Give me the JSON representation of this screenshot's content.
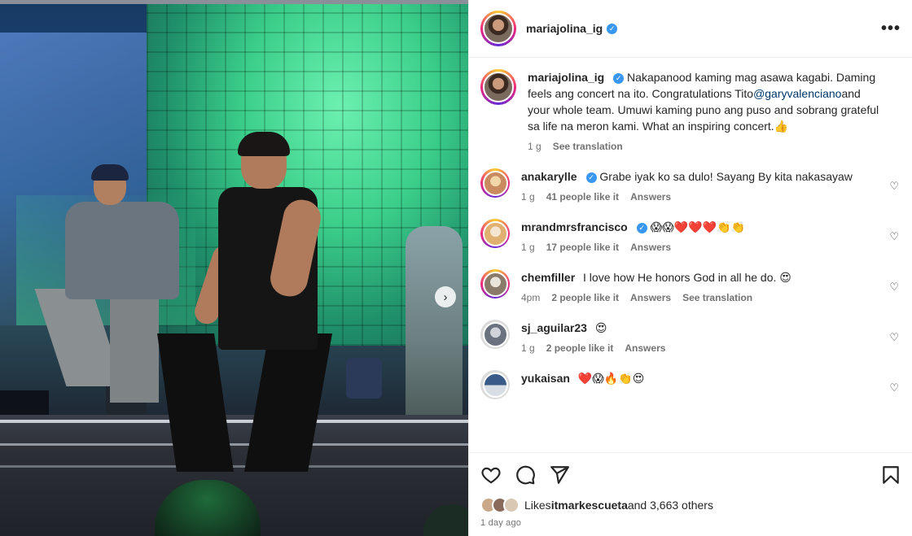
{
  "post": {
    "username": "mariajolina_ig",
    "verified_label": "✓",
    "more_label": "•••",
    "next_label": "›"
  },
  "caption": {
    "username": "mariajolina_ig",
    "text_part1": "Nakapanood kaming mag asawa kagabi. Daming feels ang concert na ito. Congratulations Tito",
    "mention": "@garyvalenciano",
    "text_part2": "and your whole team. Umuwi kaming puno ang puso and sobrang grateful sa life na meron kami. What an inspiring concert.👍",
    "time": "1 g",
    "translate": "See translation"
  },
  "comments": [
    {
      "username": "anakarylle",
      "verified": true,
      "text": "Grabe iyak ko sa dulo! Sayang By kita nakasayaw",
      "time": "1 g",
      "likes": "41 people like it",
      "reply": "Answers",
      "translate": "",
      "avatar_colors": [
        "#f0d6a8",
        "#c88a5e"
      ]
    },
    {
      "username": "mrandmrsfrancisco",
      "verified": true,
      "text": "😱😱❤️❤️❤️👏👏",
      "time": "1 g",
      "likes": "17 people like it",
      "reply": "Answers",
      "translate": "",
      "avatar_colors": [
        "#f5e6d2",
        "#e0b070"
      ]
    },
    {
      "username": "chemfiller",
      "verified": false,
      "text": "I love how He honors God in all he do. 😍",
      "time": "4pm",
      "likes": "2 people like it",
      "reply": "Answers",
      "translate": "See translation",
      "avatar_colors": [
        "#e8e4dc",
        "#8a7a6a"
      ]
    },
    {
      "username": "sj_aguilar23",
      "verified": false,
      "text": "😍",
      "time": "1 g",
      "likes": "2 people like it",
      "reply": "Answers",
      "translate": "",
      "avatar_colors": [
        "#cfd3da",
        "#6a7280"
      ]
    },
    {
      "username": "yukaisan",
      "verified": false,
      "text": "❤️😱🔥👏😍",
      "time": "",
      "likes": "",
      "reply": "",
      "translate": "",
      "avatar_colors": [
        "#3a5a8a",
        "#d8dde6"
      ]
    }
  ],
  "footer": {
    "likes_prefix": "Likes ",
    "likes_user": "itmarkescueta",
    "likes_suffix": "and 3,663 others",
    "posted": "1 day ago"
  },
  "icons": {
    "like": "heart-icon",
    "comment": "comment-icon",
    "share": "send-icon",
    "save": "bookmark-icon"
  },
  "colors": {
    "verified": "#3897f0",
    "mention": "#00376b",
    "muted": "#737373",
    "text": "#262626"
  }
}
